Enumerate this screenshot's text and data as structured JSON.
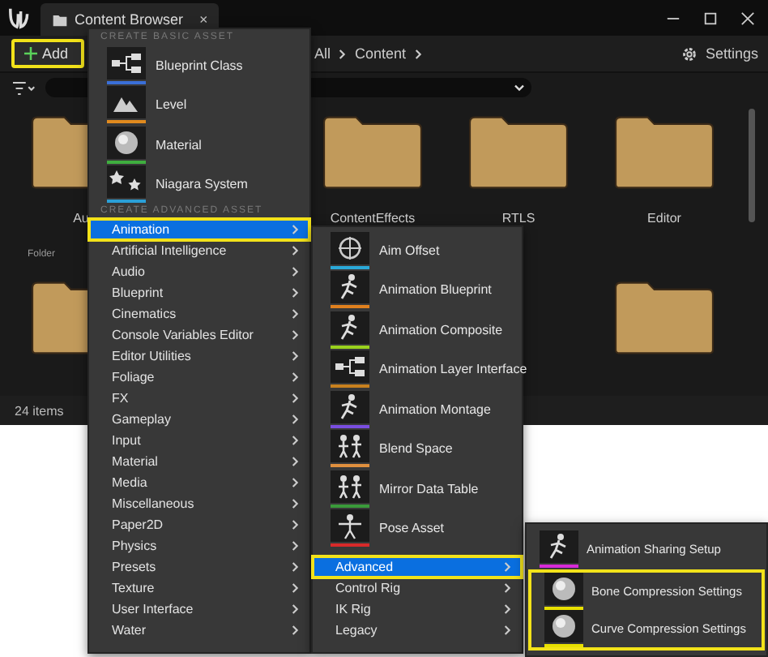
{
  "window": {
    "tab_title": "Content Browser",
    "close": "×"
  },
  "toolbar": {
    "add_button": "Add",
    "breadcrumb": [
      "All",
      "Content"
    ],
    "settings": "Settings"
  },
  "folder_rows": [
    [
      {
        "label": "Au",
        "type": "Folder"
      },
      {
        "label": "ContentEffects"
      },
      {
        "label": "RTLS"
      },
      {
        "label": "Editor"
      }
    ],
    [
      {
        "kind": "folder"
      },
      {
        "kind": "folder"
      }
    ]
  ],
  "status": "24 items",
  "add_menu": {
    "basic_header": "CREATE BASIC ASSET",
    "basic_assets": [
      {
        "label": "Blueprint Class",
        "color": "#3a6fd8",
        "kind": "blueprint"
      },
      {
        "label": "Level",
        "color": "#e08a1e",
        "kind": "level"
      },
      {
        "label": "Material",
        "color": "#3fae3f",
        "kind": "material"
      },
      {
        "label": "Niagara System",
        "color": "#2aa0d8",
        "kind": "niagara"
      }
    ],
    "advanced_header": "CREATE ADVANCED ASSET",
    "categories": [
      {
        "label": "Animation",
        "selected": true
      },
      {
        "label": "Artificial Intelligence",
        "selected": false
      },
      {
        "label": "Audio",
        "selected": false
      },
      {
        "label": "Blueprint",
        "selected": false
      },
      {
        "label": "Cinematics",
        "selected": false
      },
      {
        "label": "Console Variables Editor",
        "selected": false
      },
      {
        "label": "Editor Utilities",
        "selected": false
      },
      {
        "label": "Foliage",
        "selected": false
      },
      {
        "label": "FX",
        "selected": false
      },
      {
        "label": "Gameplay",
        "selected": false
      },
      {
        "label": "Input",
        "selected": false
      },
      {
        "label": "Material",
        "selected": false
      },
      {
        "label": "Media",
        "selected": false
      },
      {
        "label": "Miscellaneous",
        "selected": false
      },
      {
        "label": "Paper2D",
        "selected": false
      },
      {
        "label": "Physics",
        "selected": false
      },
      {
        "label": "Presets",
        "selected": false
      },
      {
        "label": "Texture",
        "selected": false
      },
      {
        "label": "User Interface",
        "selected": false
      },
      {
        "label": "Water",
        "selected": false
      }
    ]
  },
  "animation_menu": {
    "assets": [
      {
        "label": "Aim Offset",
        "color": "#2aa8d8",
        "kind": "target"
      },
      {
        "label": "Animation Blueprint",
        "color": "#e0801e",
        "kind": "runner"
      },
      {
        "label": "Animation Composite",
        "color": "#9ad21e",
        "kind": "runner"
      },
      {
        "label": "Animation Layer Interface",
        "color": "#c8801e",
        "kind": "nodes"
      },
      {
        "label": "Animation Montage",
        "color": "#7a4ee0",
        "kind": "runner"
      },
      {
        "label": "Blend Space",
        "color": "#e0903e",
        "kind": "figures"
      },
      {
        "label": "Mirror Data Table",
        "color": "#3a9a3a",
        "kind": "figures"
      },
      {
        "label": "Pose Asset",
        "color": "#d82a2a",
        "kind": "pose"
      }
    ],
    "submenus": [
      {
        "label": "Advanced",
        "selected": true
      },
      {
        "label": "Control Rig",
        "selected": false
      },
      {
        "label": "IK Rig",
        "selected": false
      },
      {
        "label": "Legacy",
        "selected": false
      }
    ]
  },
  "advanced_menu": {
    "assets": [
      {
        "label": "Animation Sharing Setup",
        "color": "#d82ad8",
        "kind": "runner",
        "highlighted": false
      },
      {
        "label": "Bone Compression Settings",
        "color": "#e8e000",
        "kind": "sphere",
        "highlighted": true
      },
      {
        "label": "Curve Compression Settings",
        "color": "#e8e000",
        "kind": "sphere",
        "highlighted": true
      }
    ]
  }
}
